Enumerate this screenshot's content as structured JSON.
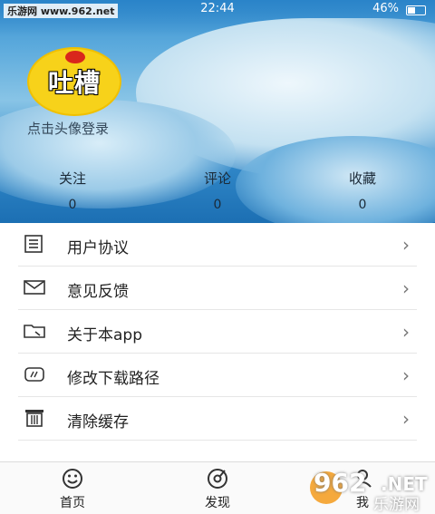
{
  "status_bar": {
    "watermark": "乐游网 www.962.net",
    "time": "22:44",
    "battery": "46%"
  },
  "profile": {
    "avatar_text": "吐槽",
    "login_hint": "点击头像登录"
  },
  "stats": [
    {
      "label": "关注",
      "count": "0"
    },
    {
      "label": "评论",
      "count": "0"
    },
    {
      "label": "收藏",
      "count": "0"
    }
  ],
  "menu": [
    {
      "label": "用户协议",
      "icon": "document-icon"
    },
    {
      "label": "意见反馈",
      "icon": "mail-icon"
    },
    {
      "label": "关于本app",
      "icon": "folder-icon"
    },
    {
      "label": "修改下载路径",
      "icon": "storage-icon"
    },
    {
      "label": "清除缓存",
      "icon": "trash-icon"
    }
  ],
  "tabbar": [
    {
      "label": "首页",
      "icon": "smiley-icon"
    },
    {
      "label": "发现",
      "icon": "compass-icon"
    },
    {
      "label": "我",
      "icon": "profile-icon"
    }
  ],
  "brand_watermark": {
    "number": "962",
    "net": ".NET",
    "cn": "乐游网"
  }
}
